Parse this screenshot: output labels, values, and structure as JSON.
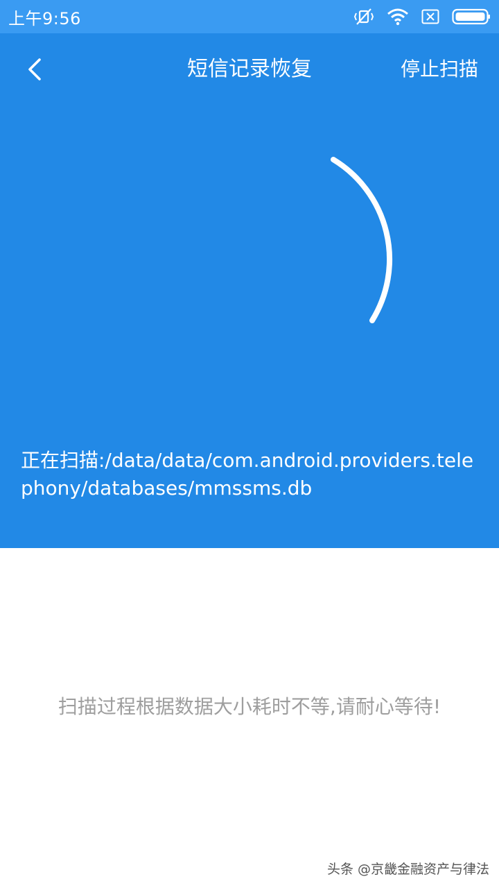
{
  "status_bar": {
    "time": "上午9:56",
    "icons": [
      "mute-vibrate-icon",
      "wifi-icon",
      "sim-x-icon",
      "battery-icon"
    ]
  },
  "header": {
    "title": "短信记录恢复",
    "stop_label": "停止扫描",
    "back_icon": "chevron-left-icon"
  },
  "scan": {
    "path_text": "正在扫描:/data/data/com.android.providers.telephony/databases/mmssms.db"
  },
  "hint": {
    "text": "扫描过程根据数据大小耗时不等,请耐心等待!"
  },
  "watermark": {
    "text": "头条 @京畿金融资产与律法"
  },
  "colors": {
    "status_bar": "#3a9bf2",
    "header_blue": "#2289e6",
    "hint_gray": "#9e9e9e"
  }
}
